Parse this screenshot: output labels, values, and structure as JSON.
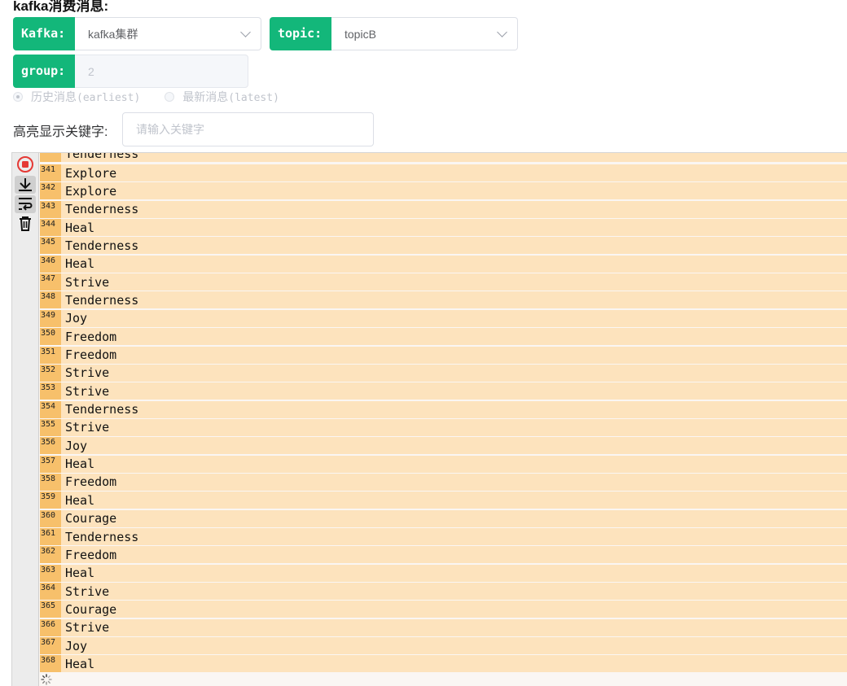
{
  "page": {
    "title": "kafka消费消息:"
  },
  "form": {
    "kafka_tag": "Kafka:",
    "kafka_value": "kafka集群",
    "topic_tag": "topic:",
    "topic_value": "topicB",
    "group_tag": "group:",
    "group_value": "2",
    "offset_options": [
      {
        "label": "历史消息",
        "mono": "(earliest)",
        "checked": true
      },
      {
        "label": "最新消息",
        "mono": "(latest)",
        "checked": false
      }
    ],
    "keyword_label": "高亮显示关键字:",
    "keyword_placeholder": "请输入关键字",
    "keyword_value": ""
  },
  "console": {
    "toolbar": [
      {
        "name": "stop-icon",
        "active": false
      },
      {
        "name": "scroll-to-bottom-icon",
        "active": true
      },
      {
        "name": "wrap-lines-icon",
        "active": true
      },
      {
        "name": "trash-icon",
        "active": false
      }
    ],
    "partial_top_line": "Tenderness",
    "lines": [
      {
        "no": "341",
        "text": "Explore"
      },
      {
        "no": "342",
        "text": "Explore"
      },
      {
        "no": "343",
        "text": "Tenderness"
      },
      {
        "no": "344",
        "text": "Heal"
      },
      {
        "no": "345",
        "text": "Tenderness"
      },
      {
        "no": "346",
        "text": "Heal"
      },
      {
        "no": "347",
        "text": "Strive"
      },
      {
        "no": "348",
        "text": "Tenderness"
      },
      {
        "no": "349",
        "text": "Joy"
      },
      {
        "no": "350",
        "text": "Freedom"
      },
      {
        "no": "351",
        "text": "Freedom"
      },
      {
        "no": "352",
        "text": "Strive"
      },
      {
        "no": "353",
        "text": "Strive"
      },
      {
        "no": "354",
        "text": "Tenderness"
      },
      {
        "no": "355",
        "text": "Strive"
      },
      {
        "no": "356",
        "text": "Joy"
      },
      {
        "no": "357",
        "text": "Heal"
      },
      {
        "no": "358",
        "text": "Freedom"
      },
      {
        "no": "359",
        "text": "Heal"
      },
      {
        "no": "360",
        "text": "Courage"
      },
      {
        "no": "361",
        "text": "Tenderness"
      },
      {
        "no": "362",
        "text": "Freedom"
      },
      {
        "no": "363",
        "text": "Heal"
      },
      {
        "no": "364",
        "text": "Strive"
      },
      {
        "no": "365",
        "text": "Courage"
      },
      {
        "no": "366",
        "text": "Strive"
      },
      {
        "no": "367",
        "text": "Joy"
      },
      {
        "no": "368",
        "text": "Heal"
      }
    ]
  },
  "colors": {
    "accent_green": "#13b77a",
    "line_bg": "#fde3bd",
    "lineno_bg": "#f7c06b",
    "stop_red": "#e53935"
  }
}
